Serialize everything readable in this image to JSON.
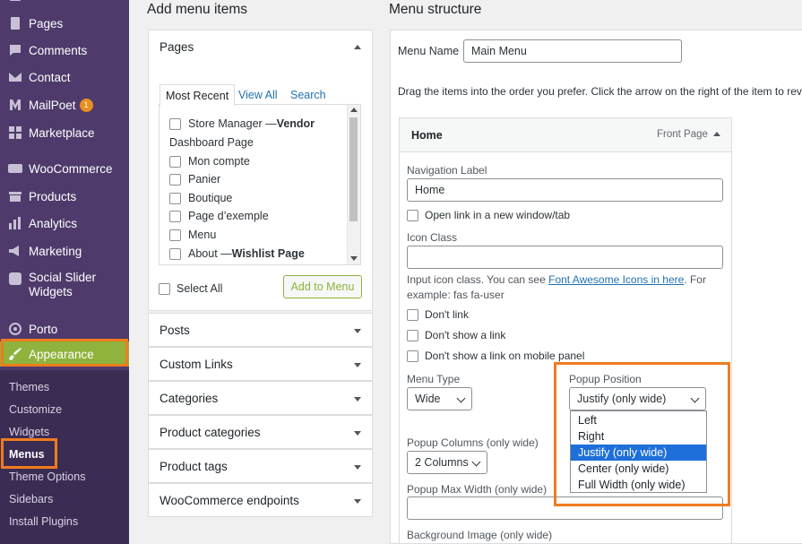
{
  "sidebar": {
    "items": [
      {
        "label": "Pages",
        "icon": "pages-icon"
      },
      {
        "label": "Comments",
        "icon": "comments-icon"
      },
      {
        "label": "Contact",
        "icon": "contact-icon"
      },
      {
        "label": "MailPoet",
        "icon": "mailpoet-icon",
        "badge": "1"
      },
      {
        "label": "Marketplace",
        "icon": "marketplace-icon"
      },
      {
        "label": "WooCommerce",
        "icon": "woocommerce-icon"
      },
      {
        "label": "Products",
        "icon": "products-icon"
      },
      {
        "label": "Analytics",
        "icon": "analytics-icon"
      },
      {
        "label": "Marketing",
        "icon": "marketing-icon"
      },
      {
        "label": "Social Slider Widgets",
        "icon": "social-slider-icon"
      },
      {
        "label": "Porto",
        "icon": "porto-icon"
      },
      {
        "label": "Appearance",
        "icon": "appearance-icon"
      }
    ],
    "submenu": [
      "Themes",
      "Customize",
      "Widgets",
      "Menus",
      "Theme Options",
      "Sidebars",
      "Install Plugins"
    ],
    "current_submenu": "Menus"
  },
  "add_items": {
    "heading": "Add menu items",
    "pages_panel": {
      "title": "Pages",
      "tabs": [
        "Most Recent",
        "View All",
        "Search"
      ],
      "items": [
        {
          "text": "Store Manager — ",
          "bold": "Vendor"
        },
        {
          "text": "Dashboard Page",
          "bold": "",
          "continuation": true
        },
        {
          "text": "Mon compte",
          "bold": ""
        },
        {
          "text": "Panier",
          "bold": ""
        },
        {
          "text": "Boutique",
          "bold": ""
        },
        {
          "text": "Page d’exemple",
          "bold": ""
        },
        {
          "text": "Menu",
          "bold": ""
        },
        {
          "text": "About — ",
          "bold": "Wishlist Page"
        }
      ],
      "select_all": "Select All",
      "add_button": "Add to Menu"
    },
    "collapsed_panels": [
      "Posts",
      "Custom Links",
      "Categories",
      "Product categories",
      "Product tags",
      "WooCommerce endpoints"
    ]
  },
  "structure": {
    "heading": "Menu structure",
    "menu_name_label": "Menu Name",
    "menu_name_value": "Main Menu",
    "instructions": "Drag the items into the order you prefer. Click the arrow on the right of the item to reve",
    "item": {
      "title": "Home",
      "type": "Front Page",
      "nav_label_label": "Navigation Label",
      "nav_label_value": "Home",
      "new_window": "Open link in a new window/tab",
      "icon_class_label": "Icon Class",
      "icon_help_prefix": "Input icon class. You can see ",
      "icon_help_link": "Font Awesome Icons in here",
      "icon_help_suffix": ". For",
      "icon_help_line2": "example: fas fa-user",
      "dont_link": "Don't link",
      "dont_show_link": "Don't show a link",
      "dont_show_mobile": "Don't show a link on mobile panel",
      "menu_type_label": "Menu Type",
      "menu_type_value": "Wide",
      "popup_position_label": "Popup Position",
      "popup_position_value": "Justify (only wide)",
      "popup_position_options": [
        "Left",
        "Right",
        "Justify (only wide)",
        "Center (only wide)",
        "Full Width (only wide)"
      ],
      "popup_columns_label": "Popup Columns (only wide)",
      "popup_columns_value": "2 Columns",
      "popup_max_width_label": "Popup Max Width (only wide)",
      "background_image_label": "Background Image (only wide)"
    }
  },
  "colors": {
    "sidebar": "#4e3a6b",
    "submenu": "#3b2c54",
    "accent_green": "#8fb33c",
    "highlight_orange": "#f07b1f",
    "option_selected": "#1e6fd9",
    "link": "#2271b1"
  }
}
